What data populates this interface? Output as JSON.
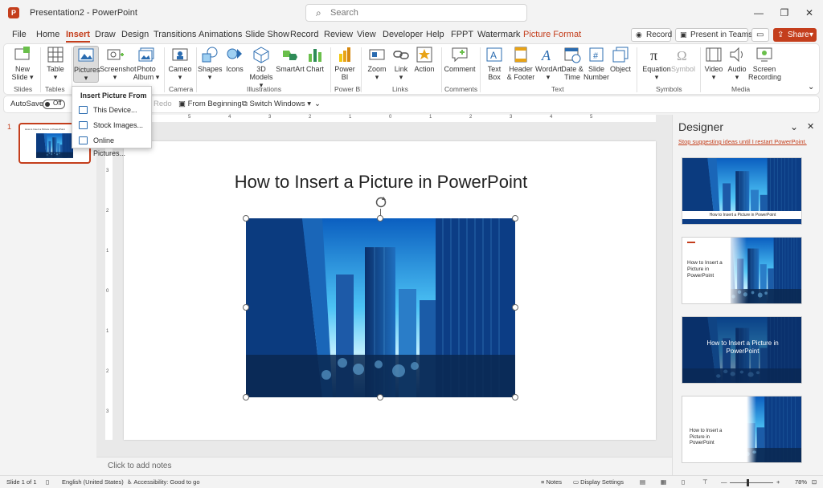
{
  "titlebar": {
    "logo": "P",
    "doc_title": "Presentation2  -  PowerPoint",
    "search_placeholder": "Search",
    "minimize": "—",
    "restore": "❐",
    "close": "✕"
  },
  "tabs": [
    {
      "label": "File"
    },
    {
      "label": "Home"
    },
    {
      "label": "Insert"
    },
    {
      "label": "Draw"
    },
    {
      "label": "Design"
    },
    {
      "label": "Transitions"
    },
    {
      "label": "Animations"
    },
    {
      "label": "Slide Show"
    },
    {
      "label": "Record"
    },
    {
      "label": "Review"
    },
    {
      "label": "View"
    },
    {
      "label": "Developer"
    },
    {
      "label": "Help"
    },
    {
      "label": "FPPT"
    },
    {
      "label": "Watermark"
    },
    {
      "label": "Picture Format"
    }
  ],
  "top_buttons": {
    "record": "Record",
    "present_in_teams": "Present in Teams",
    "share": "Share"
  },
  "ribbon": {
    "new_slide": [
      "New",
      "Slide ▾"
    ],
    "table": [
      "Table",
      "▾"
    ],
    "pictures": [
      "Pictures",
      "▾"
    ],
    "screenshot": [
      "Screenshot",
      "▾"
    ],
    "photo_album": [
      "Photo",
      "Album ▾"
    ],
    "cameo": [
      "Cameo",
      "▾"
    ],
    "shapes": [
      "Shapes",
      "▾"
    ],
    "icons": [
      "Icons"
    ],
    "models_3d": [
      "3D",
      "Models ▾"
    ],
    "smartart": [
      "SmartArt"
    ],
    "chart": [
      "Chart"
    ],
    "power_bi": [
      "Power",
      "BI"
    ],
    "zoom": [
      "Zoom",
      "▾"
    ],
    "link": [
      "Link",
      "▾"
    ],
    "action": [
      "Action"
    ],
    "comment": [
      "Comment"
    ],
    "text_box": [
      "Text",
      "Box"
    ],
    "header_footer": [
      "Header",
      "& Footer"
    ],
    "wordart": [
      "WordArt",
      "▾"
    ],
    "date_time": [
      "Date &",
      "Time"
    ],
    "slide_number": [
      "Slide",
      "Number"
    ],
    "object": [
      "Object"
    ],
    "equation": [
      "Equation ▾"
    ],
    "symbol": [
      "Symbol"
    ],
    "video": [
      "Video",
      "▾"
    ],
    "audio": [
      "Audio",
      "▾"
    ],
    "screen_recording": [
      "Screen",
      "Recording"
    ],
    "groups": {
      "slides": "Slides",
      "tables": "Tables",
      "camera": "Camera",
      "illustrations": "Illustrations",
      "power_bi": "Power BI",
      "links": "Links",
      "comments": "Comments",
      "text": "Text",
      "symbols": "Symbols",
      "media": "Media"
    }
  },
  "qat": {
    "autosave": "AutoSave",
    "toggle": "Off",
    "redo": "Redo",
    "from_beginning": "From Beginning",
    "switch_windows": "Switch Windows ▾"
  },
  "pictures_menu": {
    "header": "Insert Picture From",
    "items": [
      "This Device...",
      "Stock Images...",
      "Online Pictures..."
    ]
  },
  "thumbnails": {
    "number": "1",
    "title": "How to Insert a Picture in PowerPoint"
  },
  "ruler": {
    "h": [
      "5",
      "4",
      "3",
      "2",
      "1",
      "0",
      "1",
      "2",
      "3",
      "4",
      "5"
    ],
    "v": [
      "3",
      "2",
      "1",
      "0",
      "1",
      "2",
      "3"
    ]
  },
  "slide": {
    "title": "How to Insert a Picture in PowerPoint"
  },
  "notes": {
    "placeholder": "Click to add notes"
  },
  "designer": {
    "title": "Designer",
    "stop_link": "Stop suggesting ideas until I restart PowerPoint.",
    "card1_caption": "How to Insert a Picture in PowerPoint",
    "card2_text": [
      "How to Insert a",
      "Picture in",
      "PowerPoint"
    ],
    "card3_text": [
      "How to Insert a Picture in",
      "PowerPoint"
    ],
    "card4_text": [
      "How to Insert a",
      "Picture in",
      "PowerPoint"
    ]
  },
  "statusbar": {
    "slide_of": "Slide 1 of 1",
    "language": "English (United States)",
    "accessibility": "Accessibility: Good to go",
    "notes": "Notes",
    "display_settings": "Display Settings",
    "zoom_minus": "—",
    "zoom_plus": "+",
    "zoom": "78%"
  },
  "colors": {
    "accent": "#c43e1c",
    "sky_light": "#39b6f0",
    "sky_dark": "#0a3a7a"
  }
}
